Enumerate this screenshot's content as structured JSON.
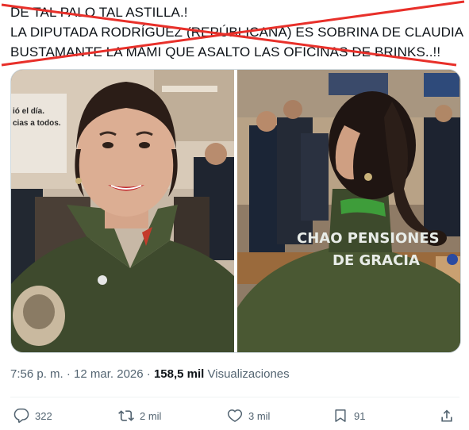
{
  "post": {
    "lines": [
      "DE TAL PALO TAL ASTILLA.!",
      "LA DIPUTADA RODRÍGUEZ (REPÚBLICANA) ES SOBRINA DE CLAUDIA",
      "BUSTAMANTE LA MAMI QUE  ASALTO LAS OFICINAS DE BRINKS..!!"
    ],
    "cross_color": "#e8302a"
  },
  "media": {
    "left_screen_text_1": "ió el día.",
    "left_screen_text_2": "cias a todos.",
    "jacket_line_1": "CHAO PENSIONES",
    "jacket_line_2": "DE GRACIA"
  },
  "meta": {
    "time": "7:56 p. m.",
    "separator": "·",
    "date": "12 mar. 2026",
    "views_count": "158,5 mil",
    "views_label": "Visualizaciones"
  },
  "actions": {
    "replies": "322",
    "reposts": "2 mil",
    "likes": "3 mil",
    "bookmarks": "91"
  },
  "icons": {
    "reply": "reply-icon",
    "repost": "repost-icon",
    "like": "heart-icon",
    "bookmark": "bookmark-icon",
    "share": "share-icon"
  },
  "colors": {
    "text": "#0f1419",
    "secondary": "#536471",
    "border": "#cfd9de"
  }
}
